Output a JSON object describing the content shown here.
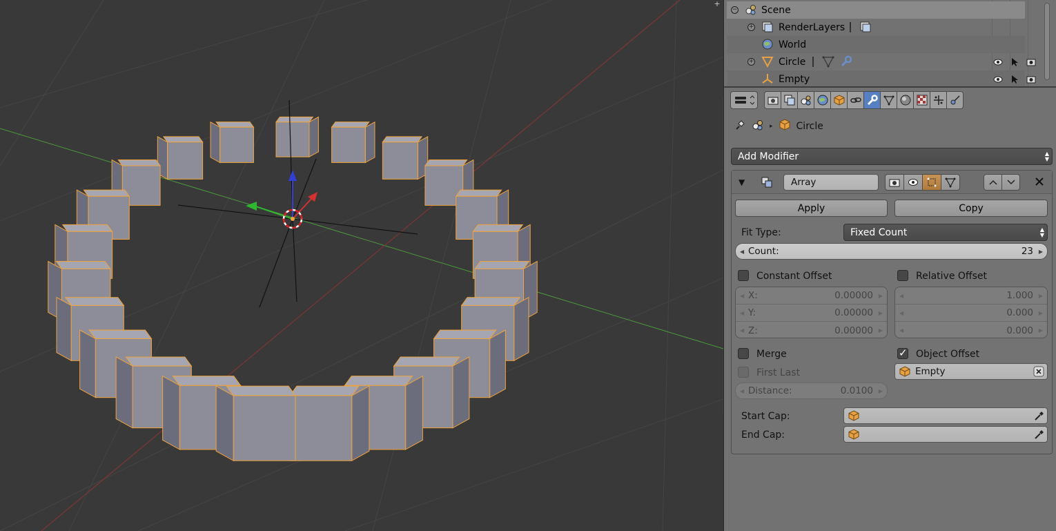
{
  "outliner": {
    "rows": [
      {
        "label": "Scene"
      },
      {
        "label": "RenderLayers"
      },
      {
        "label": "World"
      },
      {
        "label": "Circle"
      },
      {
        "label": "Empty"
      }
    ]
  },
  "properties": {
    "breadcrumb": {
      "object": "Circle"
    },
    "add_modifier_label": "Add Modifier",
    "modifier": {
      "name": "Array",
      "apply_label": "Apply",
      "copy_label": "Copy",
      "fit_type_label": "Fit Type:",
      "fit_type_value": "Fixed Count",
      "count_label": "Count:",
      "count_value": "23",
      "constant_offset_label": "Constant Offset",
      "relative_offset_label": "Relative Offset",
      "constant": {
        "x_label": "X:",
        "x": "0.00000",
        "y_label": "Y:",
        "y": "0.00000",
        "z_label": "Z:",
        "z": "0.00000"
      },
      "relative": {
        "x": "1.000",
        "y": "0.000",
        "z": "0.000"
      },
      "merge_label": "Merge",
      "first_last_label": "First Last",
      "distance_label": "Distance:",
      "distance_value": "0.0100",
      "object_offset_label": "Object Offset",
      "object_offset_value": "Empty",
      "start_cap_label": "Start Cap:",
      "end_cap_label": "End Cap:"
    }
  },
  "colors": {
    "viewport_bg": "#393939",
    "panel_bg": "#727272",
    "active_tab": "#5680c2",
    "selection_outline": "#f1a33a",
    "cube_face": "#9495a0"
  }
}
